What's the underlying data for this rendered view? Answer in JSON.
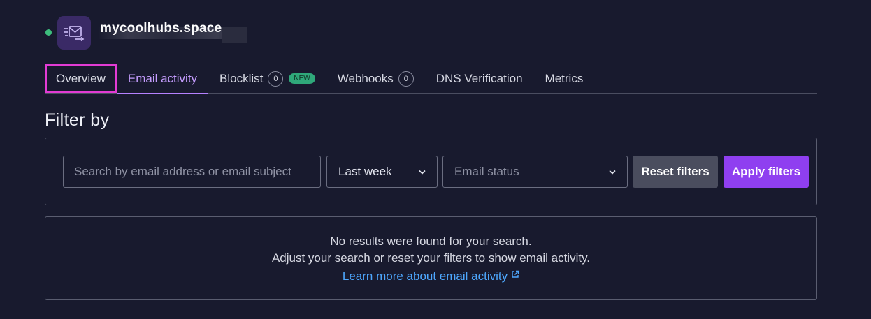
{
  "header": {
    "domain": "mycoolhubs.space",
    "status_color": "#3dbd7d",
    "icon": "mail-icon"
  },
  "tabs": [
    {
      "label": "Overview"
    },
    {
      "label": "Email activity"
    },
    {
      "label": "Blocklist",
      "count": "0",
      "badge": "NEW"
    },
    {
      "label": "Webhooks",
      "count": "0"
    },
    {
      "label": "DNS Verification"
    },
    {
      "label": "Metrics"
    }
  ],
  "filter": {
    "title": "Filter by",
    "search_placeholder": "Search by email address or email subject",
    "range_value": "Last week",
    "status_placeholder": "Email status",
    "reset_label": "Reset filters",
    "apply_label": "Apply filters"
  },
  "results": {
    "line1": "No results were found for your search.",
    "line2": "Adjust your search or reset your filters to show email activity.",
    "link_label": "Learn more about email activity"
  },
  "colors": {
    "accent": "#8f3ff0",
    "active_tab": "#c59dff",
    "link": "#4ea8ff",
    "highlight": "#e23bd4"
  }
}
